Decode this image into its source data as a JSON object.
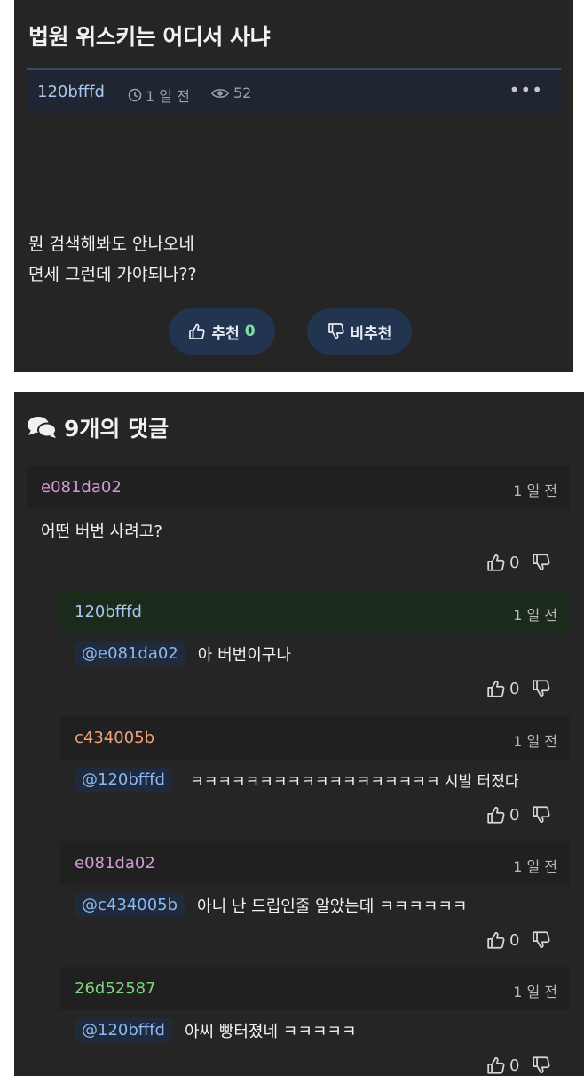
{
  "post": {
    "title": "법원 위스키는 어디서 사냐",
    "author": "120bfffd",
    "time": "1 일 전",
    "views": "52",
    "more": "•••",
    "body_lines": [
      "뭔 검색해봐도 안나오네",
      "면세 그런데 가야되나??"
    ],
    "upvote_label": "추천",
    "upvote_count": "0",
    "downvote_label": "비추천"
  },
  "comments": {
    "header": "9개의 댓글",
    "items": [
      {
        "author": "e081da02",
        "author_color": "#d39ad6",
        "time": "1 일 전",
        "mention": "",
        "text": "어떤 버번 사려고?",
        "likes": "0"
      },
      {
        "author": "120bfffd",
        "author_color": "#a9c7f2",
        "time": "1 일 전",
        "mention": "@e081da02",
        "text": "아 버번이구나",
        "likes": "0"
      },
      {
        "author": "c434005b",
        "author_color": "#f0a27a",
        "time": "1 일 전",
        "mention": "@120bfffd",
        "text": "ㅋㅋㅋㅋㅋㅋㅋㅋㅋㅋㅋㅋㅋㅋㅋㅋㅋㅋ 시발 터졌다",
        "likes": "0"
      },
      {
        "author": "e081da02",
        "author_color": "#d39ad6",
        "time": "1 일 전",
        "mention": "@c434005b",
        "text": "아니 난 드립인줄 알았는데 ㅋㅋㅋㅋㅋㅋ",
        "likes": "0"
      },
      {
        "author": "26d52587",
        "author_color": "#7fd27f",
        "time": "1 일 전",
        "mention": "@120bfffd",
        "text": "아씨 빵터졌네 ㅋㅋㅋㅋㅋ",
        "likes": "0"
      }
    ]
  },
  "icons": {
    "clock": "clock-icon",
    "eye": "eye-icon",
    "thumb_up": "thumbs-up-icon",
    "thumb_down": "thumbs-down-icon",
    "comments": "comments-icon"
  }
}
